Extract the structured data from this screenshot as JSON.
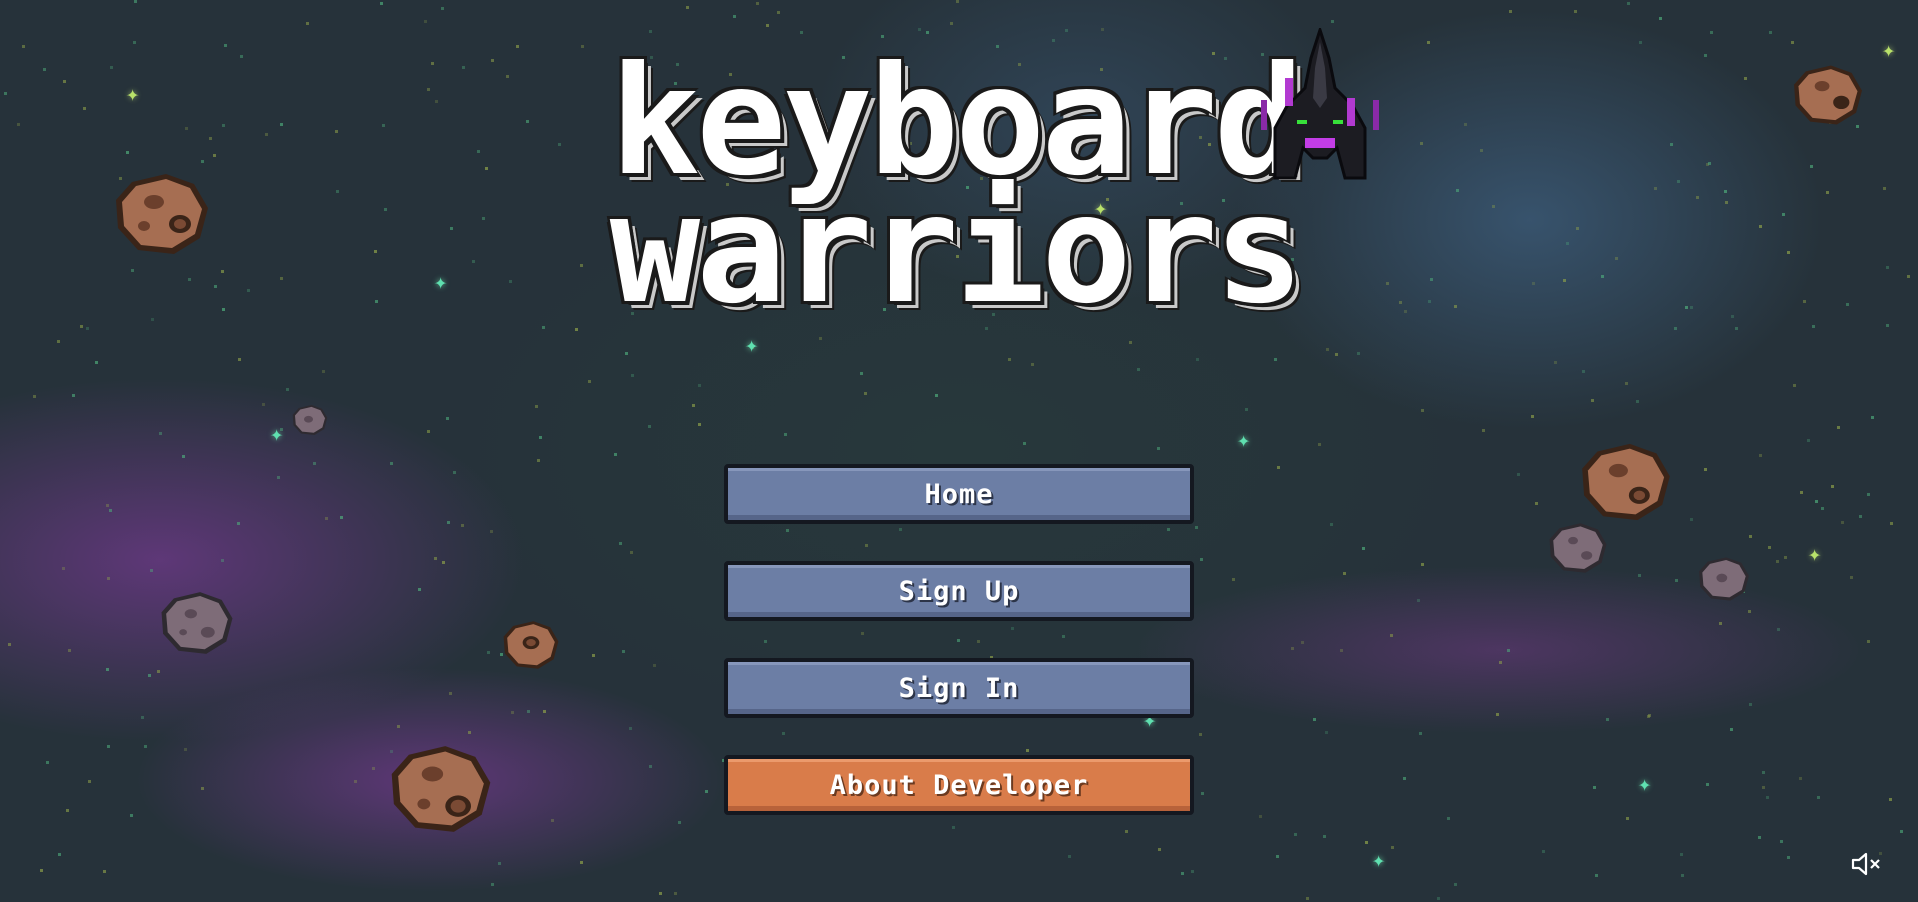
{
  "title": {
    "line1": "keyboard",
    "line2": "warriors"
  },
  "menu": {
    "items": [
      {
        "label": "Home"
      },
      {
        "label": "Sign Up"
      },
      {
        "label": "Sign In"
      },
      {
        "label": "About Developer"
      }
    ]
  },
  "icons": {
    "mute": "speaker-muted-icon",
    "ship": "spaceship-icon",
    "asteroid": "asteroid-icon",
    "star": "sparkle-star-icon"
  },
  "colors": {
    "button": "#6c7ea5",
    "accent_button": "#d97c4a",
    "background": "#26323a"
  }
}
